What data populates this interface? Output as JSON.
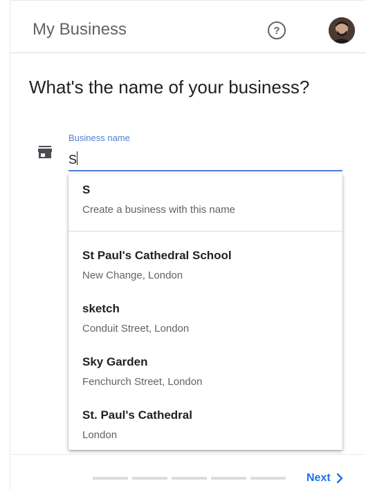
{
  "app": {
    "title": "My Business"
  },
  "header": {
    "help_glyph": "?"
  },
  "page": {
    "heading": "What's the name of your business?"
  },
  "form": {
    "label": "Business name",
    "value": "S"
  },
  "suggestions": [
    {
      "title": "S",
      "subtitle": "Create a business with this name"
    },
    {
      "title": "St Paul's Cathedral School",
      "subtitle": "New Change, London"
    },
    {
      "title": "sketch",
      "subtitle": "Conduit Street, London"
    },
    {
      "title": "Sky Garden",
      "subtitle": "Fenchurch Street, London"
    },
    {
      "title": "St. Paul's Cathedral",
      "subtitle": "London"
    }
  ],
  "footer": {
    "next_label": "Next",
    "progress_steps": 5
  },
  "colors": {
    "accent": "#4a7fd6",
    "next": "#1a73e8",
    "text": "#202124",
    "muted": "#5f6368"
  },
  "icons": {
    "help": "help-circle-icon",
    "store": "storefront-icon",
    "next": "chevron-right-icon",
    "avatar": "user-avatar"
  }
}
